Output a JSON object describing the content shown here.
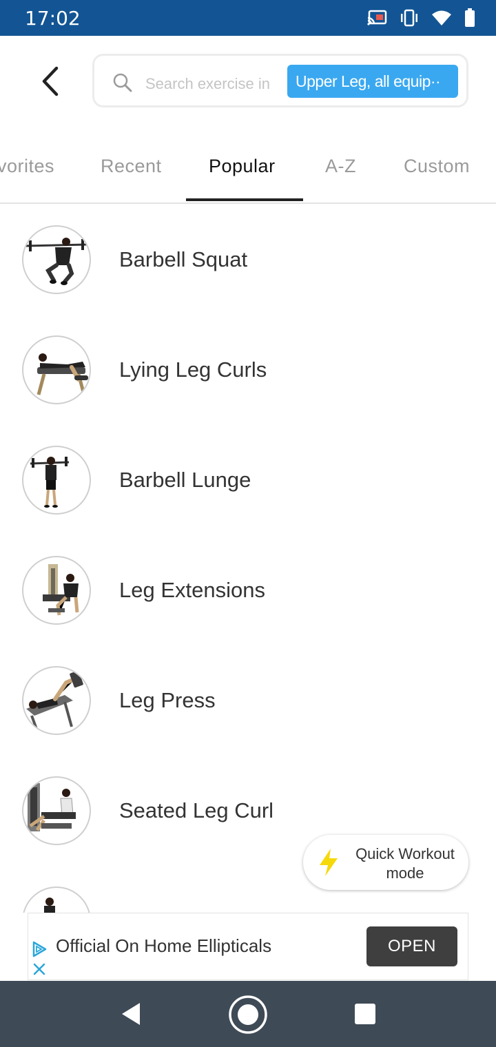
{
  "status_bar": {
    "time": "17:02",
    "icons": [
      "cast-icon",
      "vibrate-icon",
      "wifi-icon",
      "battery-icon"
    ],
    "background": "#135594"
  },
  "header": {
    "back_icon": "chevron-left-icon",
    "search": {
      "placeholder": "Search exercise in",
      "filter_chip": "Upper Leg, all equip··",
      "chip_color": "#3aa8f0"
    }
  },
  "tabs": [
    {
      "label": "vorites",
      "active": false
    },
    {
      "label": "Recent",
      "active": false
    },
    {
      "label": "Popular",
      "active": true
    },
    {
      "label": "A-Z",
      "active": false
    },
    {
      "label": "Custom",
      "active": false
    }
  ],
  "exercises": [
    {
      "name": "Barbell Squat",
      "icon": "barbell-squat-thumbnail"
    },
    {
      "name": "Lying Leg Curls",
      "icon": "lying-leg-curl-thumbnail"
    },
    {
      "name": "Barbell Lunge",
      "icon": "barbell-lunge-thumbnail"
    },
    {
      "name": "Leg Extensions",
      "icon": "leg-extension-thumbnail"
    },
    {
      "name": "Leg Press",
      "icon": "leg-press-thumbnail"
    },
    {
      "name": "Seated Leg Curl",
      "icon": "seated-leg-curl-thumbnail"
    },
    {
      "name": "",
      "icon": "exercise-thumbnail"
    }
  ],
  "quick_workout": {
    "label_line1": "Quick Workout",
    "label_line2": "mode",
    "icon": "lightning-icon",
    "icon_color": "#f5d90a"
  },
  "ad": {
    "text": "Official On Home Ellipticals",
    "button": "OPEN",
    "icons": [
      "ad-choices-icon",
      "close-icon"
    ],
    "accent": "#2aa6d9"
  },
  "nav_bar": {
    "icons": [
      "back-triangle-icon",
      "home-circle-icon",
      "recents-square-icon"
    ],
    "background": "#3e4a56"
  }
}
